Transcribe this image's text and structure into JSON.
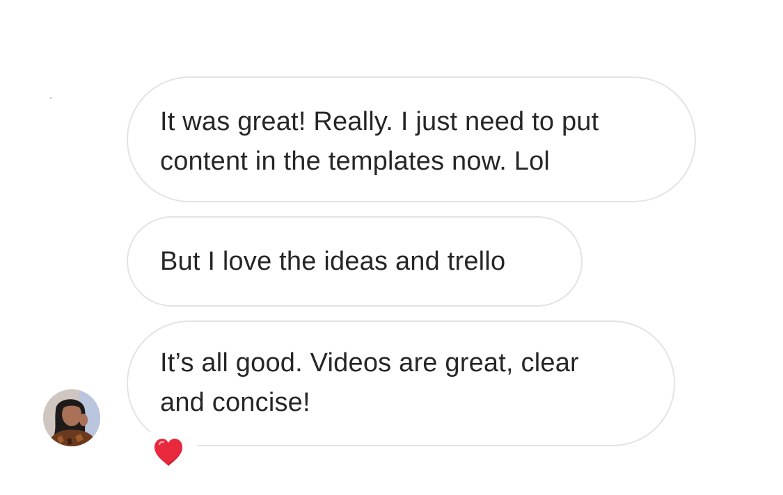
{
  "messages": [
    {
      "lines": [
        "It was great! Really. I just need to put",
        "content in the templates now. Lol"
      ]
    },
    {
      "lines": [
        "But I love the ideas and trello"
      ]
    },
    {
      "lines": [
        "It’s all good. Videos are great, clear",
        "and concise!"
      ],
      "reaction": "heart-emoji"
    }
  ],
  "avatar": {
    "icon": "profile-photo"
  },
  "colors": {
    "bubble_border": "#e3e3e3",
    "text": "#262626",
    "heart": "#e8283c"
  }
}
